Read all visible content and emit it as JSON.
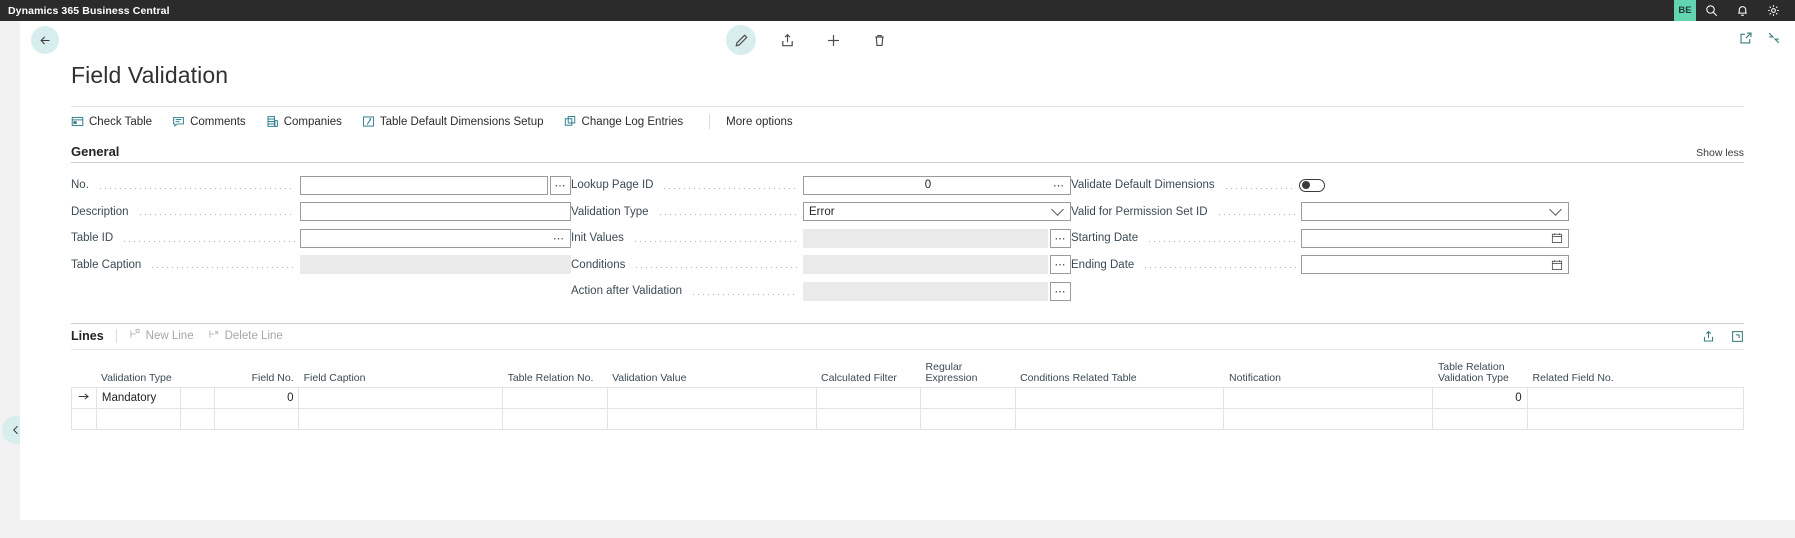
{
  "topbar": {
    "title": "Dynamics 365 Business Central",
    "env_badge": "BE",
    "icons": [
      "search-icon",
      "notification-bell-icon",
      "settings-gear-icon"
    ]
  },
  "page": {
    "title": "Field Validation",
    "back_label": "Back",
    "command_buttons": [
      {
        "name": "edit-button",
        "icon": "pencil-icon"
      },
      {
        "name": "share-button",
        "icon": "share-icon"
      },
      {
        "name": "new-button",
        "icon": "plus-icon"
      },
      {
        "name": "delete-button",
        "icon": "trash-icon"
      }
    ],
    "corner_icons": [
      {
        "name": "open-in-new-window-icon"
      },
      {
        "name": "collapse-icon"
      }
    ]
  },
  "actionbar": {
    "items": [
      {
        "label": "Check Table",
        "icon": "check-table-icon"
      },
      {
        "label": "Comments",
        "icon": "comment-icon"
      },
      {
        "label": "Companies",
        "icon": "companies-icon"
      },
      {
        "label": "Table Default Dimensions Setup",
        "icon": "dimensions-setup-icon"
      },
      {
        "label": "Change Log Entries",
        "icon": "change-log-icon"
      }
    ],
    "more_options": "More options"
  },
  "general": {
    "title": "General",
    "show_less": "Show less",
    "column1": [
      {
        "label": "No.",
        "value": "",
        "control": "text-lookup",
        "disabled": false
      },
      {
        "label": "Description",
        "value": "",
        "control": "text",
        "disabled": false
      },
      {
        "label": "Table ID",
        "value": "",
        "control": "text-inline-ellipsis",
        "disabled": false
      },
      {
        "label": "Table Caption",
        "value": "",
        "control": "text",
        "disabled": true
      }
    ],
    "column2": [
      {
        "label": "Lookup Page ID",
        "value": "0",
        "control": "number-inline-ellipsis",
        "disabled": false
      },
      {
        "label": "Validation Type",
        "value": "Error",
        "control": "dropdown",
        "disabled": false
      },
      {
        "label": "Init Values",
        "value": "",
        "control": "text-lookup",
        "disabled": true
      },
      {
        "label": "Conditions",
        "value": "",
        "control": "text-lookup",
        "disabled": true
      },
      {
        "label": "Action after Validation",
        "value": "",
        "control": "text-lookup",
        "disabled": true
      }
    ],
    "column3": [
      {
        "label": "Validate Default Dimensions",
        "value": "",
        "control": "toggle",
        "toggle_on": false
      },
      {
        "label": "Valid for Permission Set ID",
        "value": "",
        "control": "dropdown",
        "disabled": false
      },
      {
        "label": "Starting Date",
        "value": "",
        "control": "date",
        "disabled": false
      },
      {
        "label": "Ending Date",
        "value": "",
        "control": "date",
        "disabled": false
      }
    ]
  },
  "lines": {
    "title": "Lines",
    "actions": [
      {
        "label": "New Line",
        "icon": "new-line-icon",
        "disabled": true
      },
      {
        "label": "Delete Line",
        "icon": "delete-line-icon",
        "disabled": true
      }
    ],
    "right_icons": [
      {
        "name": "open-in-excel-icon"
      },
      {
        "name": "expand-lines-icon"
      }
    ],
    "columns": [
      "Validation Type",
      "Field No.",
      "Field Caption",
      "Table Relation No.",
      "Validation Value",
      "Calculated Filter",
      "Regular Expression",
      "Conditions Related Table",
      "Notification",
      "Table Relation Validation Type",
      "Related Field No.",
      "Field Caption"
    ],
    "rows": [
      {
        "selected": true,
        "cells": [
          "Mandatory",
          "",
          "0",
          "",
          "",
          "",
          "",
          "",
          "",
          "",
          "",
          "0",
          ""
        ]
      },
      {
        "selected": false,
        "cells": [
          "",
          "",
          "",
          "",
          "",
          "",
          "",
          "",
          "",
          "",
          "",
          "",
          ""
        ]
      }
    ]
  }
}
